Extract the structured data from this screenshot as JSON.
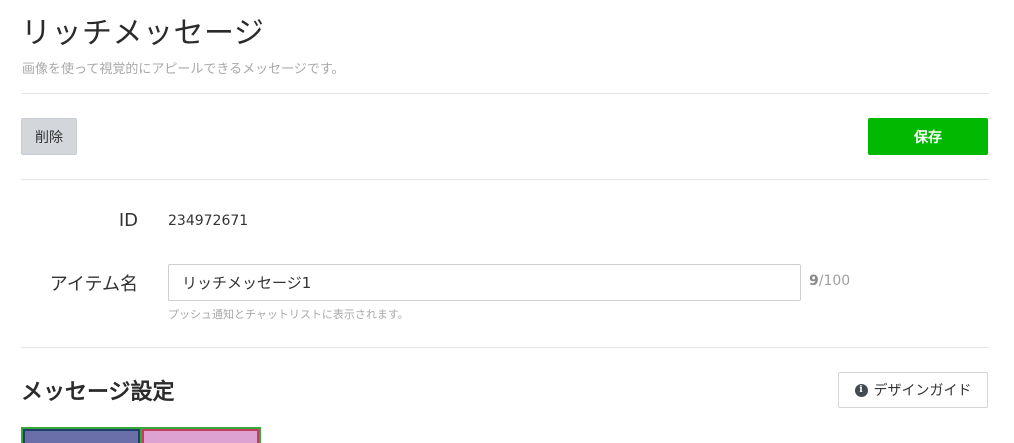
{
  "header": {
    "title": "リッチメッセージ",
    "subtitle": "画像を使って視覚的にアピールできるメッセージです。"
  },
  "toolbar": {
    "delete_label": "削除",
    "save_label": "保存"
  },
  "form": {
    "id_label": "ID",
    "id_value": "234972671",
    "name_label": "アイテム名",
    "name_value": "リッチメッセージ1",
    "name_count": "9",
    "name_max": "/100",
    "name_help": "プッシュ通知とチャットリストに表示されます。"
  },
  "message_settings": {
    "title": "メッセージ設定",
    "design_guide_label": "デザインガイド",
    "design_guide_icon": "info-icon"
  },
  "colors": {
    "accent": "#00b900",
    "preview_cell_a": "#6a6faa",
    "preview_cell_b": "#dea2d2"
  }
}
